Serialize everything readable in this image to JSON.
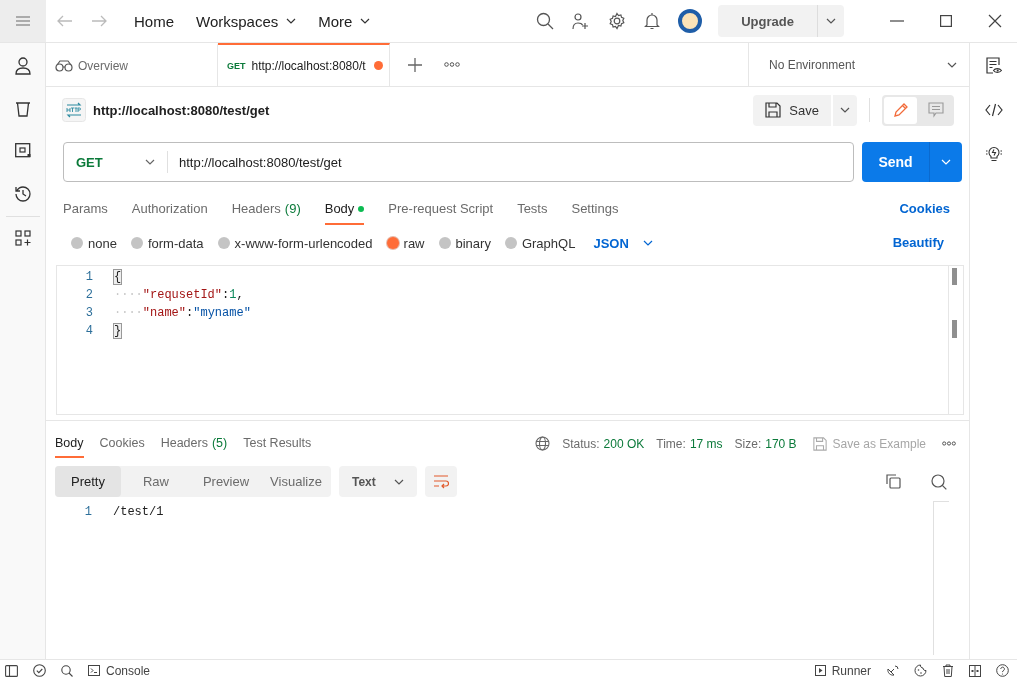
{
  "topbar": {
    "nav": [
      {
        "label": "Home",
        "dropdown": false
      },
      {
        "label": "Workspaces",
        "dropdown": true
      },
      {
        "label": "More",
        "dropdown": true
      }
    ],
    "upgrade": "Upgrade"
  },
  "tabs": [
    {
      "kind": "overview",
      "label": "Overview",
      "selected": false,
      "unsaved": false
    },
    {
      "kind": "request",
      "method": "GET",
      "label": "http://localhost:8080/t",
      "selected": true,
      "unsaved": true
    }
  ],
  "environment": "No Environment",
  "request": {
    "name": "http://localhost:8080/test/get",
    "save": "Save",
    "view_modes": [
      {
        "kind": "edit",
        "selected": true
      },
      {
        "kind": "comments",
        "selected": false
      }
    ],
    "method": "GET",
    "url": "http://localhost:8080/test/get",
    "send": "Send",
    "tabs": [
      {
        "label": "Params",
        "selected": false,
        "modified": false
      },
      {
        "label": "Authorization",
        "selected": false,
        "modified": false
      },
      {
        "label": "Headers",
        "count": "(9)",
        "selected": false,
        "modified": false
      },
      {
        "label": "Body",
        "selected": true,
        "modified": true
      },
      {
        "label": "Pre-request Script",
        "selected": false,
        "modified": false
      },
      {
        "label": "Tests",
        "selected": false,
        "modified": false
      },
      {
        "label": "Settings",
        "selected": false,
        "modified": false
      }
    ],
    "cookies": "Cookies",
    "body_modes": [
      {
        "label": "none",
        "selected": false
      },
      {
        "label": "form-data",
        "selected": false
      },
      {
        "label": "x-www-form-urlencoded",
        "selected": false
      },
      {
        "label": "raw",
        "selected": true
      },
      {
        "label": "binary",
        "selected": false
      },
      {
        "label": "GraphQL",
        "selected": false
      }
    ],
    "language": "JSON",
    "beautify": "Beautify",
    "code": [
      {
        "number": "1",
        "tokens": [
          {
            "kind": "brace",
            "text": "{"
          }
        ]
      },
      {
        "number": "2",
        "tokens": [
          {
            "kind": "indent",
            "text": "····"
          },
          {
            "kind": "key",
            "text": "\"requsetId\""
          },
          {
            "kind": "punct",
            "text": ":"
          },
          {
            "kind": "number",
            "text": "1"
          },
          {
            "kind": "punct",
            "text": ","
          }
        ]
      },
      {
        "number": "3",
        "tokens": [
          {
            "kind": "indent",
            "text": "····"
          },
          {
            "kind": "key",
            "text": "\"name\""
          },
          {
            "kind": "punct",
            "text": ":"
          },
          {
            "kind": "string",
            "text": "\"myname\""
          }
        ]
      },
      {
        "number": "4",
        "tokens": [
          {
            "kind": "brace",
            "text": "}"
          }
        ]
      }
    ]
  },
  "response": {
    "tabs": [
      {
        "label": "Body",
        "selected": true
      },
      {
        "label": "Cookies",
        "selected": false
      },
      {
        "label": "Headers",
        "count": "(5)",
        "selected": false
      },
      {
        "label": "Test Results",
        "selected": false
      }
    ],
    "status_label": "Status:",
    "status": "200 OK",
    "time_label": "Time:",
    "time": "17 ms",
    "size_label": "Size:",
    "size": "170 B",
    "save_example": "Save as Example",
    "views": [
      {
        "label": "Pretty",
        "selected": true
      },
      {
        "label": "Raw",
        "selected": false
      },
      {
        "label": "Preview",
        "selected": false
      },
      {
        "label": "Visualize",
        "selected": false
      }
    ],
    "format": "Text",
    "lines": [
      {
        "number": "1",
        "text": "/test/1"
      }
    ]
  },
  "status_bar": {
    "console": "Console",
    "runner": "Runner"
  }
}
